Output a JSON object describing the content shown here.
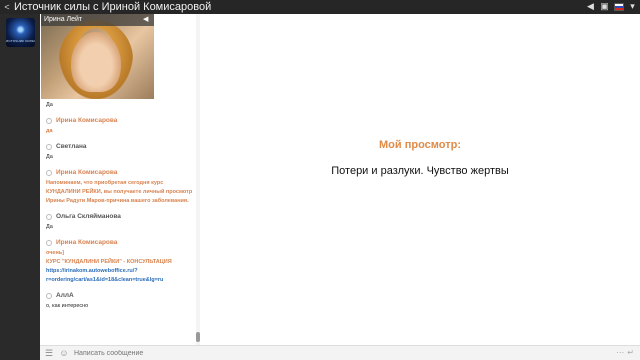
{
  "window": {
    "title": "Источник силы с Ириной Комисаровой"
  },
  "logo": {
    "text": "ИСТОЧНИК СИЛЫ"
  },
  "video": {
    "presenter_name": "Ирина Лейт"
  },
  "chat": {
    "first_line": "Да",
    "messages": [
      {
        "author": "Ирина Комисарова",
        "staff": true,
        "text": "да"
      },
      {
        "author": "Светлана",
        "staff": false,
        "text": "Да"
      },
      {
        "author": "Ирина Комисарова",
        "staff": true,
        "text": "Напоминаем, что приобретая сегодня курс КУНДАЛИНИ РЕЙКИ, вы получаете личный просмотр Ирины Радуги Маров-причина вашего заболевания."
      },
      {
        "author": "Ольга Скляйманова",
        "staff": false,
        "text": "Да"
      },
      {
        "author": "Ирина Комисарова",
        "staff": true,
        "text_pre": "очень]",
        "text_kurs": "КУРС \"КУНДАЛИНИ РЕЙКИ\" - КОНСУЛЬТАЦИЯ",
        "link": "https://irinakom.autoweboffice.ru/?r=ordering/cart/as1&id=18&clean=true&lg=ru"
      },
      {
        "author": "АллА",
        "staff": false,
        "text": "о, как интересно"
      }
    ]
  },
  "main": {
    "heading": "Мой просмотр:",
    "subtitle": "Потери и разлуки. Чувство жертвы"
  },
  "input": {
    "placeholder": "Написать сообщение"
  },
  "colors": {
    "accent": "#e08b47",
    "link": "#2a6db8",
    "topbar": "#262626"
  },
  "icons": {
    "share": "share-icon",
    "volume": "volume-icon",
    "fullscreen": "fullscreen-icon",
    "flag": "russian-flag-icon",
    "menu": "menu-icon",
    "emoji": "smiley-icon",
    "send": "enter-icon"
  }
}
